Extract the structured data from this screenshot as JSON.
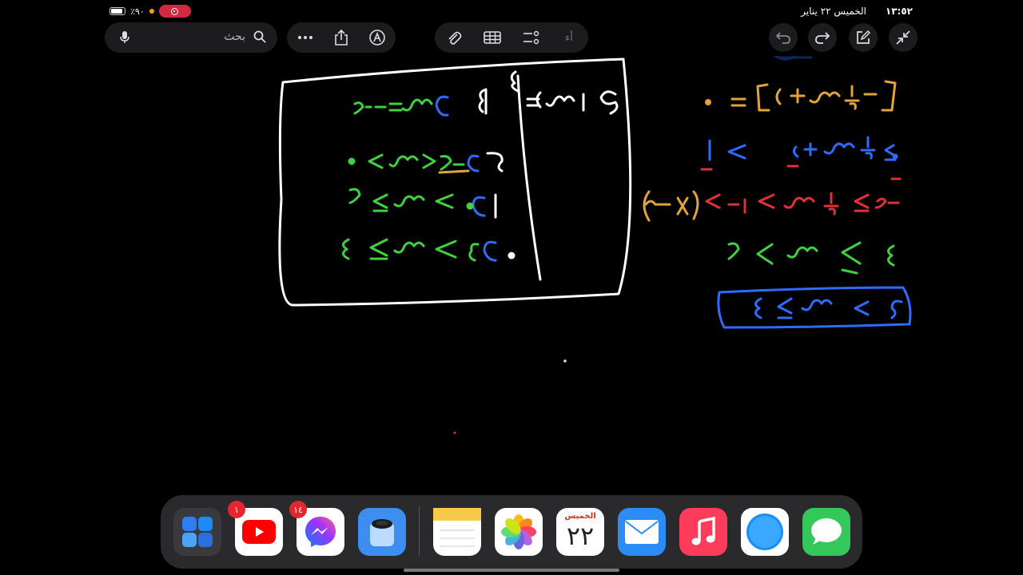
{
  "status_bar": {
    "time": "١٣:٥٢",
    "date": "الخميس ٢٢ يناير",
    "battery": "٪٩٠"
  },
  "toolbar": {
    "search_placeholder": "بحث",
    "text_format_label": "أء"
  },
  "colors": {
    "ink_white": "#ffffff",
    "ink_green": "#3fd13f",
    "ink_blue": "#2f6bff",
    "ink_red": "#e0303a",
    "ink_orange": "#e0a43a",
    "dock_bg": "#2a2a2c",
    "badge_red": "#e5262e"
  },
  "dock": {
    "apps": [
      {
        "name": "App Library",
        "badge": ""
      },
      {
        "name": "YouTube",
        "badge": "١"
      },
      {
        "name": "Messenger",
        "badge": "١٤"
      },
      {
        "name": "Dropzone",
        "badge": ""
      },
      {
        "name": "Notes",
        "badge": ""
      },
      {
        "name": "Photos",
        "badge": ""
      },
      {
        "name": "Calendar",
        "badge": ""
      },
      {
        "name": "Mail",
        "badge": ""
      },
      {
        "name": "Music",
        "badge": ""
      },
      {
        "name": "Safari",
        "badge": ""
      },
      {
        "name": "Messages",
        "badge": ""
      }
    ],
    "calendar_day": "الخميس",
    "calendar_date": "٢٢"
  },
  "note": {
    "box_header": "٣ ٤ = (٢ س) ٩",
    "box_lines": [
      "٢ = س ٢-٩",
      "٢ . < س > ٢-٢ ٩",
      "١ ٩ . > س ≥ ٢",
      ". ٩ ٢ > س ≥ ٤"
    ],
    "right_lines": [
      "٢",
      "[ -١/٢ س + ٢ ] = .",
      "٠ ≥ -١/٢ س + ٢ > ١",
      "٢- ≥ -١/٢ س > ١- (X -٢)",
      "٤ > س > ٢",
      "٢ > س ≥ ٤"
    ]
  }
}
